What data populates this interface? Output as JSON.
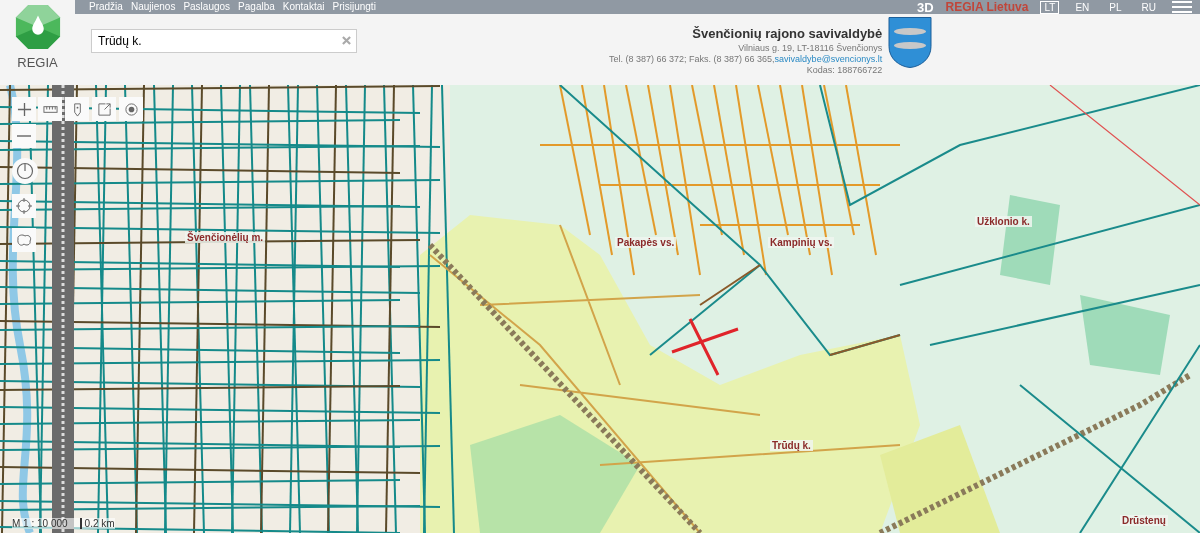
{
  "top_nav": {
    "links": [
      "Pradžia",
      "Naujienos",
      "Paslaugos",
      "Pagalba",
      "Kontaktai",
      "Prisijungti"
    ],
    "mode": "3D",
    "brand": "REGIA Lietuva",
    "languages": [
      {
        "label": "LT",
        "selected": true
      },
      {
        "label": "EN",
        "selected": false
      },
      {
        "label": "PL",
        "selected": false
      },
      {
        "label": "RU",
        "selected": false
      }
    ]
  },
  "logo": {
    "label": "REGIA"
  },
  "search": {
    "value": "Trūdų k."
  },
  "municipality": {
    "name": "Švenčionių rajono savivaldybė",
    "address": "Vilniaus g. 19, LT-18116 Švenčionys",
    "contacts": "Tel. (8 387) 66 372; Faks. (8 387) 66 365,",
    "email": "savivaldybe@svencionys.lt",
    "code": "Kodas: 188766722"
  },
  "map": {
    "labels": [
      {
        "text": "Švenčionėlių m."
      },
      {
        "text": "Pakapės vs."
      },
      {
        "text": "Kampinių vs."
      },
      {
        "text": "Užklonio k."
      },
      {
        "text": "Trūdų k."
      },
      {
        "text": "Drūstenų"
      }
    ],
    "scale": "M 1 : 10 000",
    "scale_bar": "0.2 km"
  }
}
